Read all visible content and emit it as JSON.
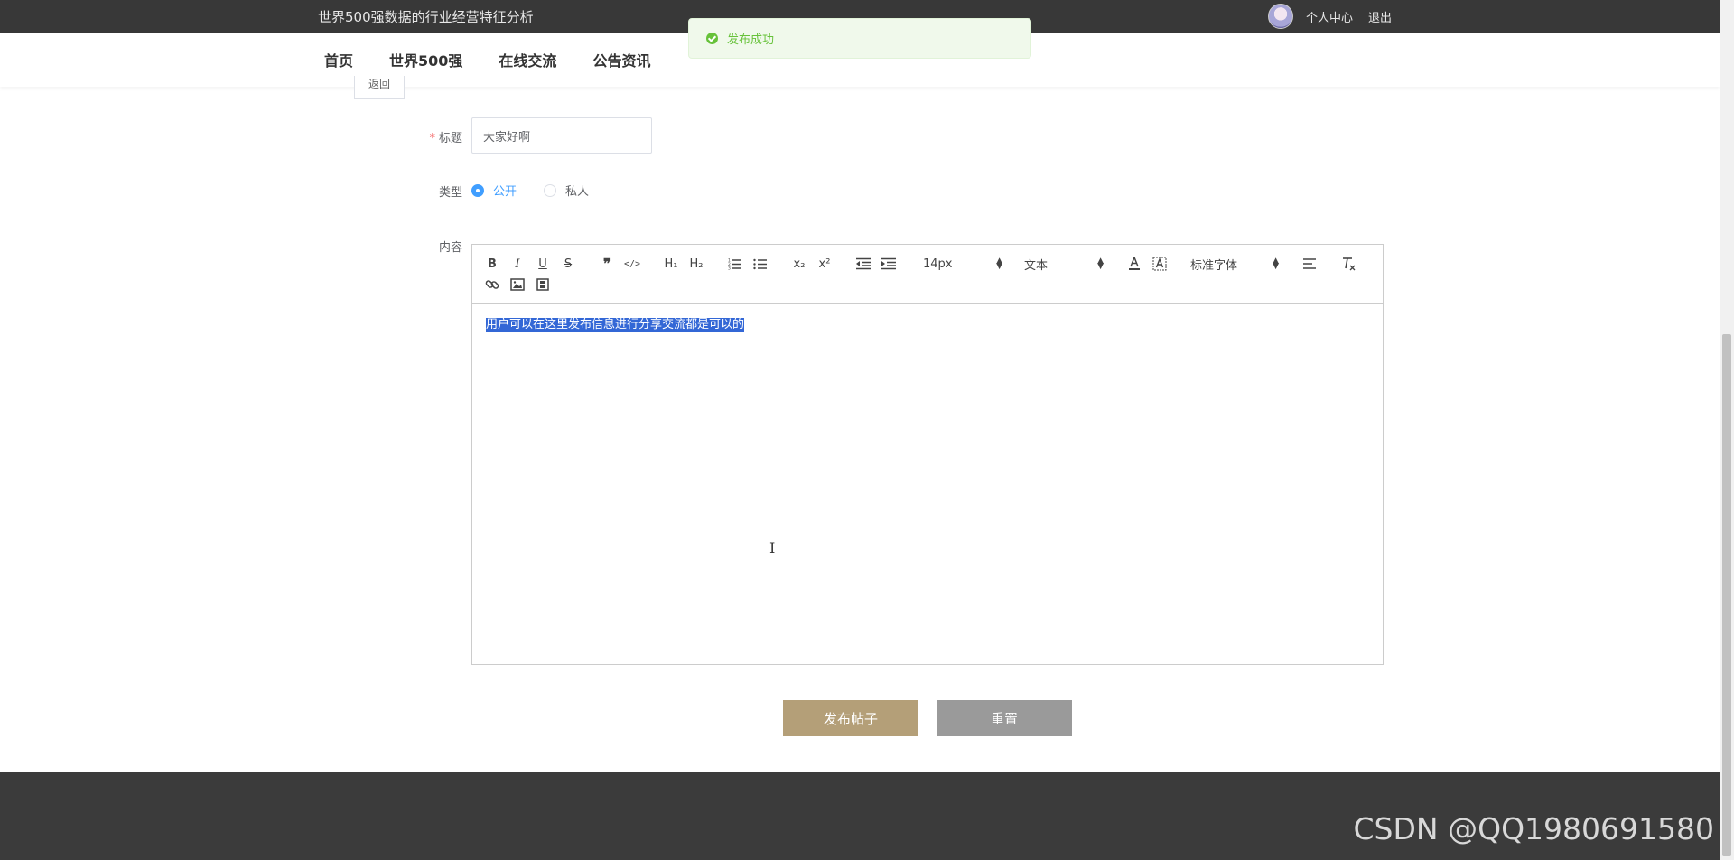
{
  "header": {
    "site_title": "世界500强数据的行业经营特征分析",
    "profile_label": "个人中心",
    "logout_label": "退出"
  },
  "nav": {
    "items": [
      {
        "label": "首页"
      },
      {
        "label": "世界500强"
      },
      {
        "label": "在线交流"
      },
      {
        "label": "公告资讯"
      }
    ]
  },
  "toast": {
    "message": "发布成功",
    "icon": "success-check-icon",
    "color": "#67c23a"
  },
  "back_button": {
    "label": "返回"
  },
  "form": {
    "title_label": "标题",
    "title_value": "大家好啊",
    "type_label": "类型",
    "type_options": [
      {
        "label": "公开",
        "checked": true
      },
      {
        "label": "私人",
        "checked": false
      }
    ],
    "content_label": "内容"
  },
  "editor": {
    "toolbar": {
      "bold": "B",
      "italic": "I",
      "underline": "U",
      "strike": "S",
      "blockquote": "❞",
      "code": "</>",
      "h1": "H₁",
      "h2": "H₂",
      "subscript": "x₂",
      "superscript": "x²",
      "font_size": "14px",
      "header_select": "文本",
      "font_family": "标准字体"
    },
    "content": "用户可以在这里发布信息进行分享交流都是可以的"
  },
  "actions": {
    "submit_label": "发布帖子",
    "reset_label": "重置"
  },
  "footer": {
    "watermark": "CSDN @QQ1980691580"
  },
  "colors": {
    "topbar": "#383838",
    "accent_blue": "#409eff",
    "submit_button": "#b49f78",
    "reset_button": "#9a9a9a",
    "footer": "#3b3b3b"
  }
}
